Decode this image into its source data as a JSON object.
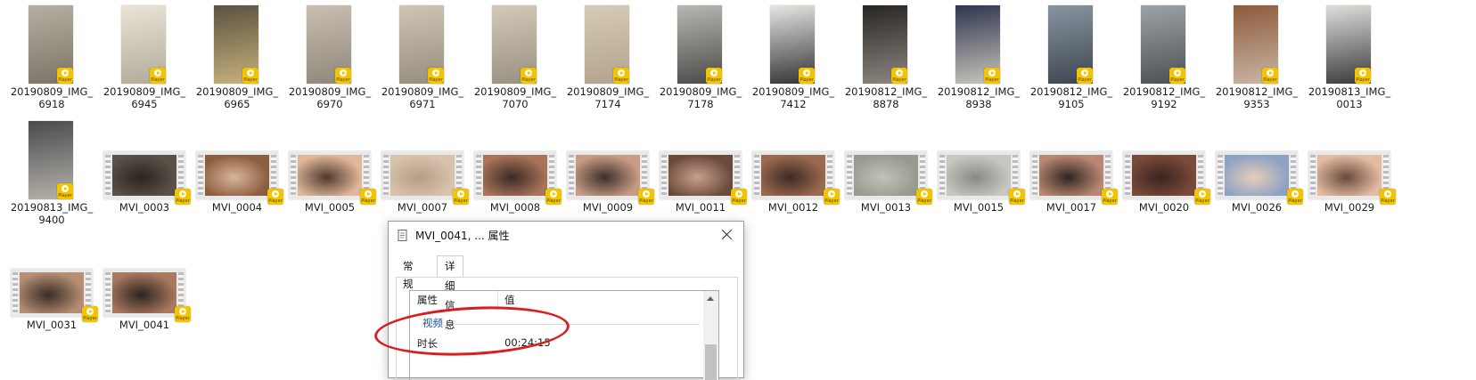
{
  "files": [
    {
      "name_l1": "20190809_IMG_",
      "name_l2": "6918",
      "kind": "image",
      "colors": [
        "#b6aea1",
        "#7c7567"
      ]
    },
    {
      "name_l1": "20190809_IMG_",
      "name_l2": "6945",
      "kind": "image",
      "colors": [
        "#e9e4d6",
        "#b2ab9a"
      ]
    },
    {
      "name_l1": "20190809_IMG_",
      "name_l2": "6965",
      "kind": "image",
      "colors": [
        "#5b5240",
        "#c7b27c"
      ]
    },
    {
      "name_l1": "20190809_IMG_",
      "name_l2": "6970",
      "kind": "image",
      "colors": [
        "#c8bfb1",
        "#8f877a"
      ]
    },
    {
      "name_l1": "20190809_IMG_",
      "name_l2": "6971",
      "kind": "image",
      "colors": [
        "#cfc5b5",
        "#978d7d"
      ]
    },
    {
      "name_l1": "20190809_IMG_",
      "name_l2": "7070",
      "kind": "image",
      "colors": [
        "#d3c9b8",
        "#9a9081"
      ]
    },
    {
      "name_l1": "20190809_IMG_",
      "name_l2": "7174",
      "kind": "image",
      "colors": [
        "#d6cbb6",
        "#b2a38c"
      ]
    },
    {
      "name_l1": "20190809_IMG_",
      "name_l2": "7178",
      "kind": "image",
      "colors": [
        "#b9b7b3",
        "#4b4a48"
      ]
    },
    {
      "name_l1": "20190809_IMG_",
      "name_l2": "7412",
      "kind": "image",
      "colors": [
        "#e8e6e3",
        "#333333"
      ]
    },
    {
      "name_l1": "20190812_IMG_",
      "name_l2": "8878",
      "kind": "image",
      "colors": [
        "#282523",
        "#8d8781"
      ]
    },
    {
      "name_l1": "20190812_IMG_",
      "name_l2": "8938",
      "kind": "image",
      "colors": [
        "#2e3550",
        "#c9c5bb"
      ]
    },
    {
      "name_l1": "20190812_IMG_",
      "name_l2": "9105",
      "kind": "image",
      "colors": [
        "#8a94a0",
        "#3d4650"
      ]
    },
    {
      "name_l1": "20190812_IMG_",
      "name_l2": "9192",
      "kind": "image",
      "colors": [
        "#9ca2a6",
        "#4c5154"
      ]
    },
    {
      "name_l1": "20190812_IMG_",
      "name_l2": "9353",
      "kind": "image",
      "colors": [
        "#8e5a3c",
        "#c9b6a5"
      ]
    },
    {
      "name_l1": "20190813_IMG_",
      "name_l2": "0013",
      "kind": "image",
      "colors": [
        "#e0dfdc",
        "#3a3a3a"
      ]
    },
    {
      "name_l1": "20190813_IMG_",
      "name_l2": "9400",
      "kind": "image",
      "colors": [
        "#4a4a4e",
        "#b7b3aa"
      ]
    },
    {
      "name_l1": "MVI_0003",
      "name_l2": "",
      "kind": "video",
      "colors": [
        "#5a5148",
        "#2a2420"
      ]
    },
    {
      "name_l1": "MVI_0004",
      "name_l2": "",
      "kind": "video",
      "colors": [
        "#8c5d3f",
        "#d9b69a"
      ]
    },
    {
      "name_l1": "MVI_0005",
      "name_l2": "",
      "kind": "video",
      "colors": [
        "#e0b79b",
        "#503a2e"
      ]
    },
    {
      "name_l1": "MVI_0007",
      "name_l2": "",
      "kind": "video",
      "colors": [
        "#d7c3ae",
        "#b69c83"
      ]
    },
    {
      "name_l1": "MVI_0008",
      "name_l2": "",
      "kind": "video",
      "colors": [
        "#a9745a",
        "#3a2a24"
      ]
    },
    {
      "name_l1": "MVI_0009",
      "name_l2": "",
      "kind": "video",
      "colors": [
        "#c89c84",
        "#3b2f2b"
      ]
    },
    {
      "name_l1": "MVI_0011",
      "name_l2": "",
      "kind": "video",
      "colors": [
        "#6b4a3c",
        "#c9a089"
      ]
    },
    {
      "name_l1": "MVI_0012",
      "name_l2": "",
      "kind": "video",
      "colors": [
        "#9b6a50",
        "#3a2a24"
      ]
    },
    {
      "name_l1": "MVI_0013",
      "name_l2": "",
      "kind": "video",
      "colors": [
        "#9a998f",
        "#c3c2b9"
      ]
    },
    {
      "name_l1": "MVI_0015",
      "name_l2": "",
      "kind": "video",
      "colors": [
        "#c8c7c2",
        "#8a8983"
      ]
    },
    {
      "name_l1": "MVI_0017",
      "name_l2": "",
      "kind": "video",
      "colors": [
        "#b98772",
        "#2f2622"
      ]
    },
    {
      "name_l1": "MVI_0020",
      "name_l2": "",
      "kind": "video",
      "colors": [
        "#7a4a3a",
        "#3a2420"
      ]
    },
    {
      "name_l1": "MVI_0026",
      "name_l2": "",
      "kind": "video",
      "colors": [
        "#8ea2c4",
        "#e6cdb9"
      ]
    },
    {
      "name_l1": "MVI_0029",
      "name_l2": "",
      "kind": "video",
      "colors": [
        "#e2bba2",
        "#6a4a3c"
      ]
    },
    {
      "name_l1": "MVI_0031",
      "name_l2": "",
      "kind": "video",
      "colors": [
        "#b58e74",
        "#3a2c26"
      ]
    },
    {
      "name_l1": "MVI_0041",
      "name_l2": "",
      "kind": "video",
      "colors": [
        "#a8785f",
        "#2d2420"
      ]
    }
  ],
  "badge_text": "Player",
  "dialog": {
    "title": "MVI_0041, ... 属性",
    "tabs": [
      "常规",
      "详细信息"
    ],
    "active_tab": "详细信息",
    "columns": [
      "属性",
      "值"
    ],
    "group": "视频",
    "property": {
      "name": "时长",
      "value": "00:24:15"
    }
  },
  "annotation_color": "#d61f1f"
}
